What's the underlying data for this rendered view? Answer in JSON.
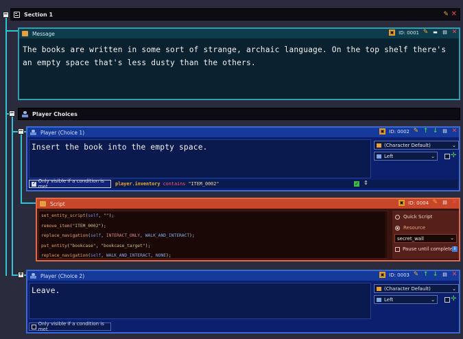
{
  "section1": {
    "title": "Section 1"
  },
  "message": {
    "header": "Message",
    "id": "ID: 0001",
    "text": "The books are written in some sort of strange, archaic language. On the top shelf there's an empty space that's less dusty than the others."
  },
  "choices_group": {
    "title": "Player Choices"
  },
  "choice1": {
    "header": "Player (Choice 1)",
    "id": "ID: 0002",
    "text": "Insert the book into the empty space.",
    "character": "(Character Default)",
    "position": "Left",
    "condition_label": "Only visible if a condition is met",
    "cond_subject": "player",
    "cond_dot": ".",
    "cond_prop": "inventory",
    "cond_op": "contains",
    "cond_value": "\"ITEM_0002\""
  },
  "script": {
    "header": "Script",
    "id": "ID: 0004",
    "lines": [
      {
        "fn": "set_entity_script",
        "open": "(",
        "a1": "self",
        "sep1": ", ",
        "a2": "\"\"",
        "close": ");"
      },
      {
        "fn": "remove_item",
        "open": "(",
        "a1": "\"ITEM_0002\"",
        "close": ");"
      },
      {
        "fn": "replace_navigation",
        "open": "(",
        "a1": "self",
        "sep1": ", ",
        "a2": "INTERACT_ONLY",
        "sep2": ", ",
        "a3": "WALK_AND_INTERACT",
        "close": ");"
      },
      {
        "fn": "put_entity",
        "open": "(",
        "a1": "\"bookcase\"",
        "sep1": ", ",
        "a2": "\"bookcase_target\"",
        "close": ");"
      },
      {
        "fn": "replace_navigation",
        "open": "(",
        "a1": "self",
        "sep1": ", ",
        "a2": "WALK_AND_INTERACT",
        "sep2": ", ",
        "a3": "NONE",
        "close": ");"
      }
    ],
    "option_quick": "Quick Script",
    "option_resource": "Resource",
    "resource_value": "secret_wall",
    "pause_label": "Pause until complete"
  },
  "choice2": {
    "header": "Player (Choice 2)",
    "id": "ID: 0003",
    "text": "Leave.",
    "character": "(Character Default)",
    "position": "Left",
    "condition_label": "Only visible if a condition is met"
  }
}
